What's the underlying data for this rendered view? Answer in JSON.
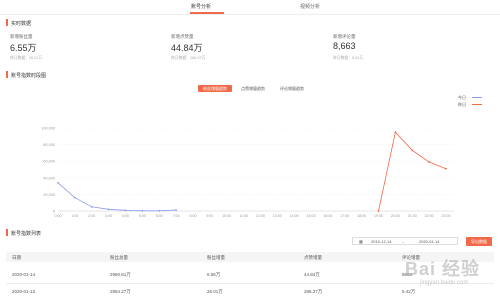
{
  "tabs": [
    {
      "label": "账号分析"
    },
    {
      "label": "视频分析"
    }
  ],
  "realtime": {
    "title": "实时数据",
    "stats": [
      {
        "label": "新增粉丝量",
        "value": "6.55万",
        "sub": "昨日数据：26.01万"
      },
      {
        "label": "新增点赞量",
        "value": "44.84万",
        "sub": "昨日数据：286.37万"
      },
      {
        "label": "新增评论量",
        "value": "8,663",
        "sub": "昨日数据：5.42万"
      }
    ]
  },
  "trend": {
    "title": "账号指数时段图",
    "tabs": [
      "粉丝增量趋势",
      "点赞增量趋势",
      "评论增量趋势"
    ],
    "active_tab": 0,
    "legend": [
      {
        "name": "今日",
        "color": "#8a9af0"
      },
      {
        "name": "昨日",
        "color": "#f06a4a"
      }
    ]
  },
  "chart_data": {
    "type": "line",
    "x": [
      "0:00",
      "1:00",
      "2:00",
      "3:00",
      "4:00",
      "5:00",
      "6:00",
      "7:00",
      "8:00",
      "9:00",
      "10:00",
      "11:00",
      "12:00",
      "13:00",
      "14:00",
      "15:00",
      "16:00",
      "17:00",
      "18:00",
      "19:00",
      "20:00",
      "21:00",
      "22:00",
      "23:00"
    ],
    "ylim": [
      0,
      100000
    ],
    "yticks": [
      "0",
      "20,000",
      "40,000",
      "60,000",
      "80,000",
      "100,000"
    ],
    "series": [
      {
        "name": "今日",
        "color": "#8a9af0",
        "values": [
          34000,
          16000,
          5000,
          2000,
          800,
          300,
          200,
          1200,
          null,
          null,
          null,
          null,
          null,
          null,
          null,
          null,
          null,
          null,
          null,
          null,
          null,
          null,
          null,
          null
        ]
      },
      {
        "name": "昨日",
        "color": "#f06a4a",
        "values": [
          null,
          null,
          null,
          null,
          null,
          null,
          null,
          null,
          null,
          null,
          null,
          null,
          null,
          null,
          null,
          null,
          null,
          null,
          null,
          0,
          95000,
          73000,
          59000,
          51000
        ]
      }
    ]
  },
  "list": {
    "title": "账号指数列表",
    "date_start": "2019-12-14",
    "date_sep": "→",
    "date_end": "2020-01-14",
    "export_label": "导出数据",
    "columns": [
      "日期",
      "粉丝总量",
      "粉丝增量",
      "点赞增量",
      "评论增量"
    ],
    "rows": [
      [
        "2020-01-14",
        "2960.81万",
        "6.55万",
        "44.84万",
        "8663"
      ],
      [
        "2020-01-13",
        "2954.27万",
        "26.01万",
        "286.37万",
        "5.42万"
      ]
    ]
  },
  "watermark": {
    "main": "Bai 经验",
    "sub": "jingyan.baidu.com"
  }
}
